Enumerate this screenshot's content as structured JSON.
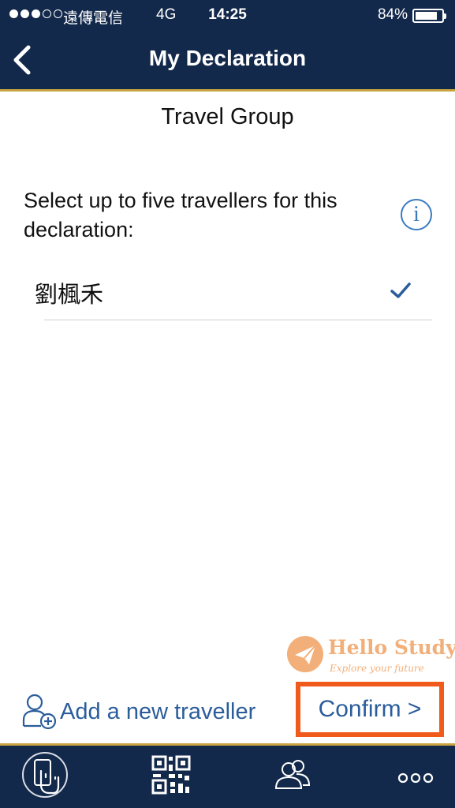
{
  "status_bar": {
    "carrier": "遠傳電信",
    "network": "4G",
    "time": "14:25",
    "battery": "84%",
    "battery_level": 0.84
  },
  "nav": {
    "title": "My Declaration"
  },
  "content": {
    "section_title": "Travel Group",
    "instruction": "Select up to five travellers for this declaration:",
    "info_symbol": "i",
    "travellers": [
      {
        "name": "劉楓禾",
        "selected": true
      }
    ]
  },
  "watermark": {
    "title": "Hello Study",
    "subtitle": "Explore your future"
  },
  "actions": {
    "add_traveller": "Add a new traveller",
    "confirm": "Confirm >"
  },
  "tabbar": {
    "icons": [
      "touch-hand-icon",
      "qr-code-icon",
      "group-icon",
      "more-icon"
    ]
  },
  "colors": {
    "nav_bg": "#13294b",
    "accent_gold": "#c9a441",
    "link_blue": "#2b5d9b",
    "highlight_orange": "#f05a1a"
  }
}
